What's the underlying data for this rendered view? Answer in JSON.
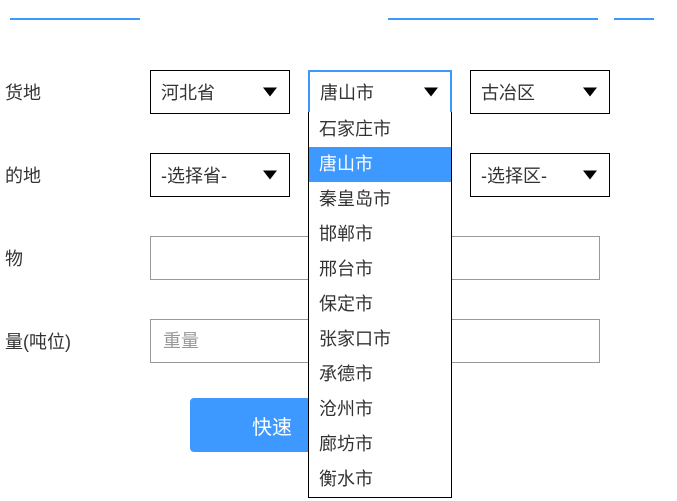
{
  "labels": {
    "origin": "货地",
    "destination": "的地",
    "goods": "物",
    "weight": "量(吨位)"
  },
  "origin": {
    "province": "河北省",
    "city": "唐山市",
    "district": "古冶区"
  },
  "destination": {
    "province": "-选择省-",
    "district": "-选择区-"
  },
  "weight_placeholder": "重量",
  "submit_label": "快速",
  "city_options": [
    "石家庄市",
    "唐山市",
    "秦皇岛市",
    "邯郸市",
    "邢台市",
    "保定市",
    "张家口市",
    "承德市",
    "沧州市",
    "廊坊市",
    "衡水市"
  ],
  "city_selected_index": 1
}
